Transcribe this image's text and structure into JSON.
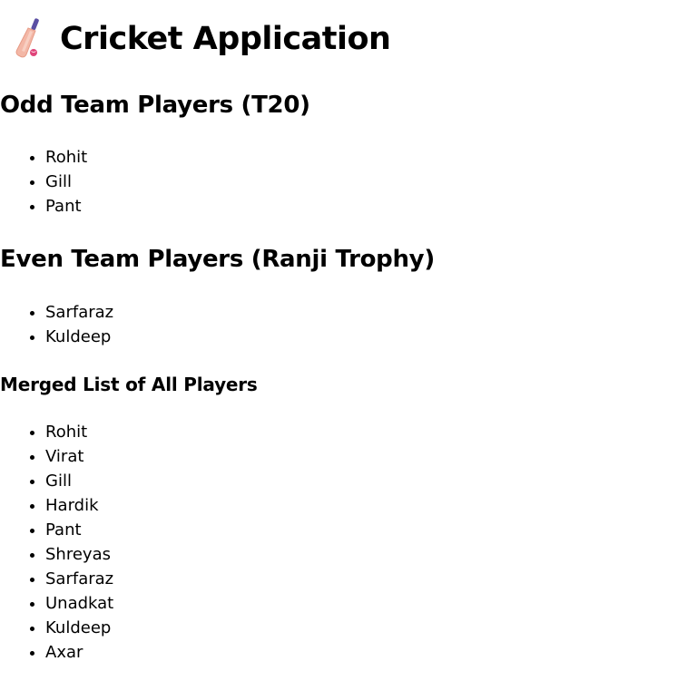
{
  "app": {
    "title": "Cricket Application",
    "icon": "cricket-bat-icon"
  },
  "odd_team": {
    "heading": "Odd Team Players (T20)",
    "players": [
      "Rohit",
      "Gill",
      "Pant"
    ]
  },
  "even_team": {
    "heading": "Even Team Players (Ranji Trophy)",
    "players": [
      "Sarfaraz",
      "Kuldeep"
    ]
  },
  "merged": {
    "heading": "Merged List of All Players",
    "players": [
      "Rohit",
      "Virat",
      "Gill",
      "Hardik",
      "Pant",
      "Shreyas",
      "Sarfaraz",
      "Unadkat",
      "Kuldeep",
      "Axar"
    ]
  },
  "colors": {
    "text": "#000000",
    "background": "#ffffff",
    "bat_blade": "#f3b7a6",
    "bat_handle": "#5b4fa3",
    "ball": "#e0447a"
  }
}
